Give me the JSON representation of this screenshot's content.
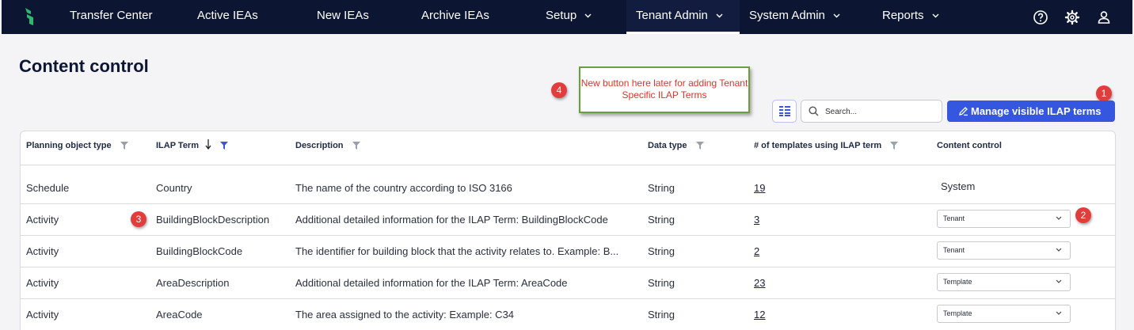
{
  "nav": {
    "items": [
      {
        "label": "Transfer Center",
        "has_menu": false
      },
      {
        "label": "Active IEAs",
        "has_menu": false
      },
      {
        "label": "New IEAs",
        "has_menu": false
      },
      {
        "label": "Archive IEAs",
        "has_menu": false
      },
      {
        "label": "Setup",
        "has_menu": true
      },
      {
        "label": "Tenant Admin",
        "has_menu": true,
        "active": true
      },
      {
        "label": "System Admin",
        "has_menu": true
      },
      {
        "label": "Reports",
        "has_menu": true
      }
    ],
    "right_icons": [
      "help-icon",
      "gear-icon",
      "user-icon"
    ]
  },
  "page": {
    "title": "Content control"
  },
  "annotation": {
    "note": "New button here later for adding Tenant Specific ILAP Terms",
    "markers": [
      "1",
      "2",
      "3",
      "4"
    ]
  },
  "toolbar": {
    "columns_icon": "columns-icon",
    "search_placeholder": "Search...",
    "manage_label": "Manage visible ILAP terms"
  },
  "table": {
    "columns": [
      {
        "label": "Planning object type",
        "filter": true
      },
      {
        "label": "ILAP Term",
        "sort": "desc",
        "filter": true,
        "filter_active": true
      },
      {
        "label": "Description",
        "filter": true
      },
      {
        "label": "Data type",
        "filter": true
      },
      {
        "label": "# of templates using ILAP term",
        "filter": true
      },
      {
        "label": "Content control",
        "filter": false
      }
    ],
    "rows": [
      {
        "type": "Schedule",
        "term": "Country",
        "description": "The name of the country according to ISO 3166",
        "data_type": "String",
        "templates": "19",
        "control": "System",
        "control_editable": false
      },
      {
        "type": "Activity",
        "term": "BuildingBlockDescription",
        "description": "Additional detailed information for the ILAP Term: BuildingBlockCode",
        "data_type": "String",
        "templates": "3",
        "control": "Tenant",
        "control_editable": true
      },
      {
        "type": "Activity",
        "term": "BuildingBlockCode",
        "description": "The identifier for building block that the activity relates to. Example: B...",
        "data_type": "String",
        "templates": "2",
        "control": "Tenant",
        "control_editable": true
      },
      {
        "type": "Activity",
        "term": "AreaDescription",
        "description": "Additional detailed information for the ILAP Term: AreaCode",
        "data_type": "String",
        "templates": "23",
        "control": "Template",
        "control_editable": true
      },
      {
        "type": "Activity",
        "term": "AreaCode",
        "description": "The area assigned to the activity: Example: C34",
        "data_type": "String",
        "templates": "12",
        "control": "Template",
        "control_editable": true
      }
    ]
  },
  "colors": {
    "nav_bg": "#0c1633",
    "primary": "#3557e0",
    "marker": "#e23d3d",
    "note_border": "#6aa03a",
    "note_text": "#d9362b",
    "logo": "#2fb86e"
  }
}
